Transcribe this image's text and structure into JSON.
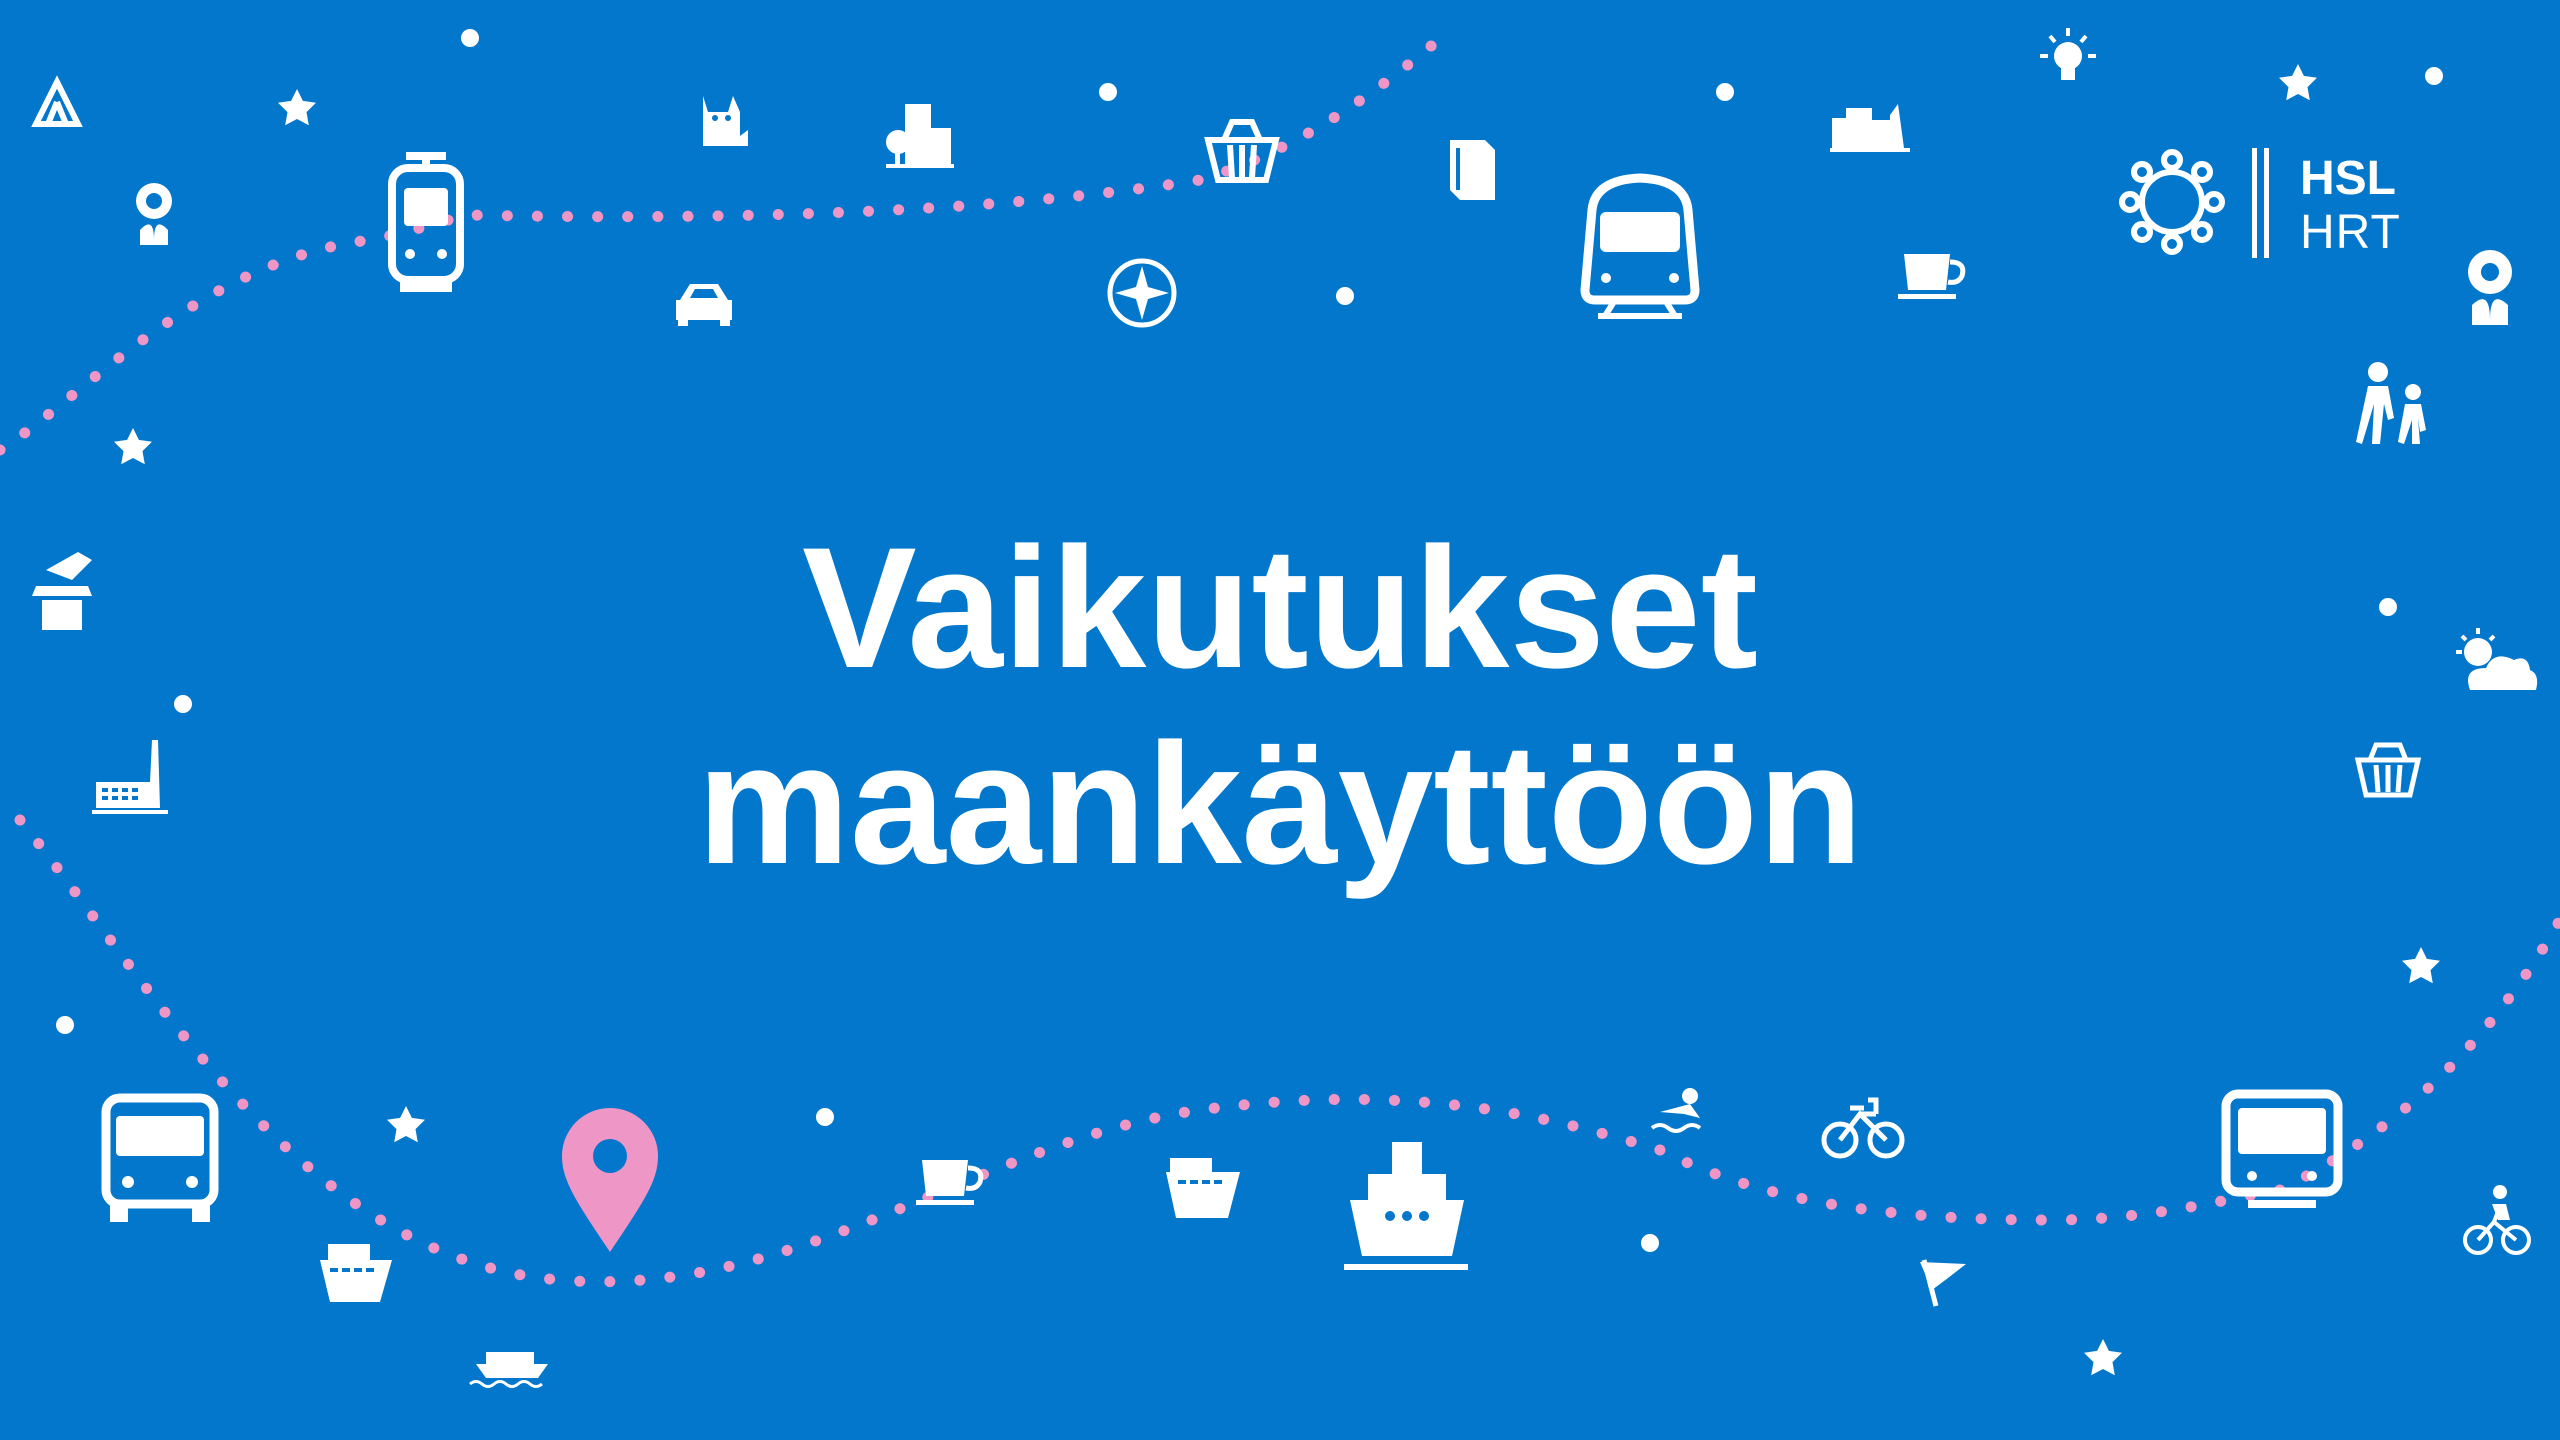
{
  "slide": {
    "title_line1": "Vaikutukset",
    "title_line2": "maankäyttöön",
    "background_color": "#0277cc",
    "dot_color": "#ee97c7",
    "icon_color": "#ffffff",
    "pin_color": "#ee97c7"
  },
  "logo": {
    "line1": "HSL",
    "line2": "HRT",
    "icon": "hsl-sun-logo-icon"
  },
  "icons": [
    "tent-icon",
    "star-icon",
    "cat-icon",
    "city-buildings-icon",
    "shopping-basket-icon",
    "book-icon",
    "factory-buildings-icon",
    "lightbulb-icon",
    "flower-icon",
    "tram-icon",
    "car-icon",
    "compass-icon",
    "train-icon",
    "coffee-cup-icon",
    "walking-people-icon",
    "magic-hat-icon",
    "factory-icon",
    "sun-cloud-icon",
    "bus-icon",
    "location-pin-icon",
    "ship-icon",
    "swimmer-icon",
    "city-bike-icon",
    "metro-icon",
    "cyclist-icon",
    "flag-icon",
    "ferry-icon",
    "boat-icon",
    "dot-icon"
  ]
}
